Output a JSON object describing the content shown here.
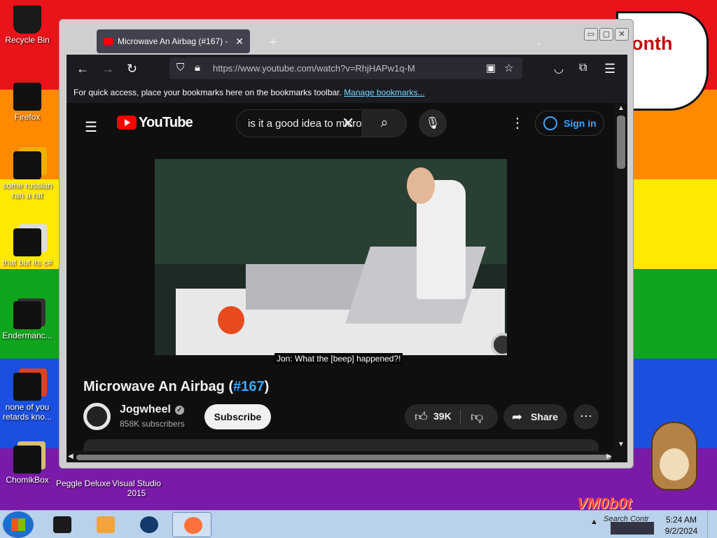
{
  "desktop": {
    "banner_text": "onth",
    "brand_text": "VM0b0t",
    "icons": [
      {
        "label": "Recycle Bin"
      },
      {
        "label": "Firefox"
      },
      {
        "label": "some russian ran a rat"
      },
      {
        "label": "that but its c#"
      },
      {
        "label": "Endermanc..."
      },
      {
        "label": "none of you retards kno..."
      },
      {
        "label": "ChomikBox"
      },
      {
        "label": "Peggle Deluxe"
      },
      {
        "label": "Visual Studio 2015"
      }
    ]
  },
  "browser": {
    "tab": {
      "title": "Microwave An Airbag (#167) - ",
      "close": "✕"
    },
    "new_tab": "+",
    "tab_list": "⌄",
    "window_controls": {
      "minimize": "▭",
      "maximize": "▢",
      "close": "✕"
    },
    "nav": {
      "back": "←",
      "forward": "→",
      "reload": "↻"
    },
    "url": "https://www.youtube.com/watch?v=RhjHAPw1q-M",
    "bookmarks_bar": {
      "text": "For quick access, place your bookmarks here on the bookmarks toolbar. ",
      "link": "Manage bookmarks..."
    }
  },
  "youtube": {
    "logo_text": "YouTube",
    "search_query": "is it a good idea to microwave",
    "sign_in": "Sign in",
    "caption": "Jon: What the [beep] happened?!",
    "video_title_main": "Microwave An Airbag (",
    "video_title_link": "#167",
    "video_title_end": ")",
    "channel": {
      "name": "Jogwheel",
      "subscribers": "858K subscribers",
      "verified_glyph": "✓"
    },
    "subscribe_label": "Subscribe",
    "likes": "39K",
    "share_label": "Share",
    "more_glyph": "⋯"
  },
  "taskbar": {
    "tray_tip": "Search Contr",
    "tray_up": "▲",
    "time": "5:24 AM",
    "date": "9/2/2024"
  },
  "colors": {
    "accent": "#3ea6ff",
    "youtube_red": "#ff0000",
    "page_bg": "#0f0f0f"
  }
}
